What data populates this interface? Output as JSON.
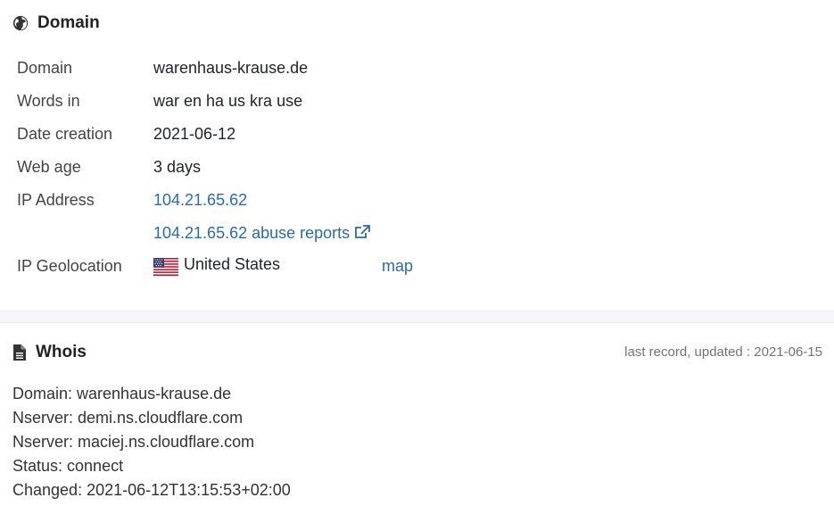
{
  "domain_section": {
    "icon": "globe-icon",
    "title": "Domain",
    "rows": {
      "domain": {
        "label": "Domain",
        "value": "warenhaus-krause.de"
      },
      "words": {
        "label": "Words in",
        "value": "war en ha us kra use"
      },
      "date": {
        "label": "Date creation",
        "value": "2021-06-12"
      },
      "age": {
        "label": "Web age",
        "value": "3 days"
      },
      "ip": {
        "label": "IP Address",
        "value": "104.21.65.62",
        "abuse_link": "104.21.65.62 abuse reports"
      },
      "geo": {
        "label": "IP Geolocation",
        "country": "United States",
        "map_link": "map"
      }
    }
  },
  "whois_section": {
    "icon": "document-icon",
    "title": "Whois",
    "updated": "last record, updated : 2021-06-15",
    "lines": [
      "Domain: warenhaus-krause.de",
      "Nserver: demi.ns.cloudflare.com",
      "Nserver: maciej.ns.cloudflare.com",
      "Status: connect",
      "Changed: 2021-06-12T13:15:53+02:00"
    ]
  },
  "colors": {
    "link": "#2a6ab0",
    "text": "#212529",
    "muted": "#6c757d"
  }
}
